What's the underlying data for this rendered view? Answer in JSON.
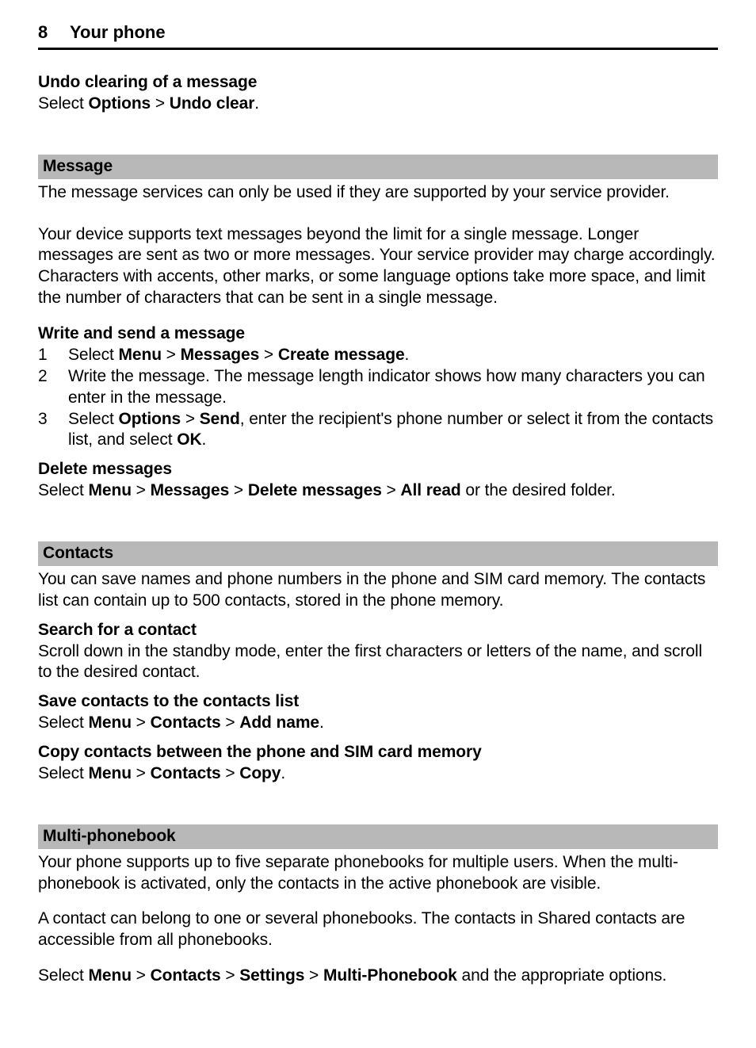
{
  "header": {
    "page_number": "8",
    "chapter_title": "Your phone"
  },
  "undo": {
    "heading": "Undo clearing of a message",
    "line_prefix": "Select ",
    "options": "Options",
    "sep": " > ",
    "undo_clear": "Undo clear",
    "period": "."
  },
  "message": {
    "bar": "Message",
    "p1": "The message services can only be used if they are supported by your service provider.",
    "p2": "Your device supports text messages beyond the limit for a single message. Longer messages are sent as two or more messages. Your service provider may charge accordingly. Characters with accents, other marks, or some language options take more space, and limit the number of characters that can be sent in a single message.",
    "write_heading": "Write and send a message",
    "steps": {
      "s1": {
        "num": "1",
        "pre": "Select ",
        "menu": "Menu",
        "sep1": " > ",
        "messages": "Messages",
        "sep2": " > ",
        "create": "Create message",
        "period": "."
      },
      "s2": {
        "num": "2",
        "text": "Write the message. The message length indicator shows how many characters you can enter in the message."
      },
      "s3": {
        "num": "3",
        "pre": "Select ",
        "options": "Options",
        "sep": " > ",
        "send": "Send",
        "mid": ", enter the recipient's phone number or select it from the contacts list, and select ",
        "ok": "OK",
        "period": "."
      }
    },
    "delete_heading": "Delete messages",
    "delete": {
      "pre": "Select ",
      "menu": "Menu",
      "sep1": " > ",
      "messages": "Messages",
      "sep2": " > ",
      "del": "Delete messages",
      "sep3": " > ",
      "all_read": "All read",
      "tail": " or the desired folder."
    }
  },
  "contacts": {
    "bar": "Contacts",
    "p1": "You can save names and phone numbers in the phone and SIM card memory. The contacts list can contain up to 500 contacts, stored in the phone memory.",
    "search_heading": "Search for a contact",
    "search_text": "Scroll down in the standby mode, enter the first characters or letters of the name, and scroll to the desired contact.",
    "save_heading": "Save contacts to the contacts list",
    "save": {
      "pre": "Select ",
      "menu": "Menu",
      "sep1": " > ",
      "contacts": "Contacts",
      "sep2": " > ",
      "add_name": "Add name",
      "period": "."
    },
    "copy_heading": "Copy contacts between the phone and SIM card memory",
    "copy": {
      "pre": "Select ",
      "menu": "Menu",
      "sep1": " > ",
      "contacts": "Contacts",
      "sep2": " > ",
      "copy": "Copy",
      "period": "."
    }
  },
  "multipb": {
    "bar": "Multi-phonebook",
    "p1": "Your phone supports up to five separate phonebooks for multiple users. When the multi-phonebook is activated, only the contacts in the active phonebook are visible.",
    "p2": "A contact can belong to one or several phonebooks. The contacts in Shared contacts are accessible from all phonebooks.",
    "nav": {
      "pre": "Select ",
      "menu": "Menu",
      "sep1": " > ",
      "contacts": "Contacts",
      "sep2": " > ",
      "settings": "Settings",
      "sep3": " > ",
      "mp": "Multi-Phonebook",
      "tail": " and the appropriate options."
    }
  }
}
